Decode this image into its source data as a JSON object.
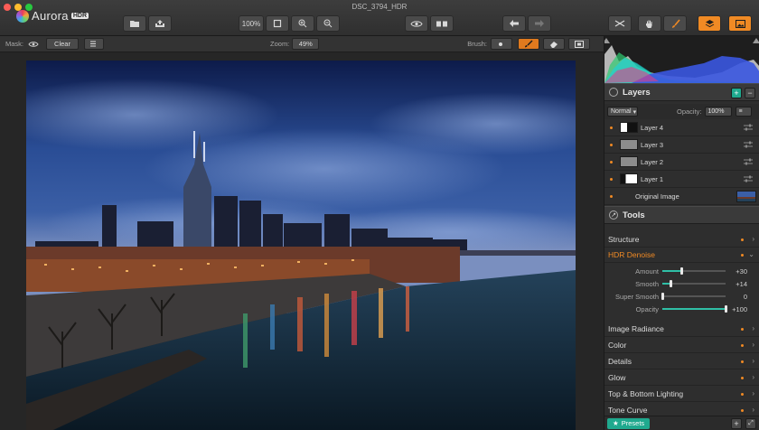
{
  "window": {
    "title": "DSC_3794_HDR"
  },
  "app": {
    "name": "Aurora",
    "badge": "HDR"
  },
  "toolbar": {
    "zoom_fit_label": "100%",
    "icons": [
      "open-icon",
      "share-icon",
      "fit-icon",
      "zoom-in-icon",
      "zoom-out-icon",
      "eye-icon",
      "compare-icon",
      "undo-icon",
      "redo-icon",
      "crop-icon",
      "hand-icon",
      "brush-tool-icon",
      "layers-icon",
      "image-view-icon"
    ]
  },
  "subbar": {
    "mask_label": "Mask:",
    "clear_label": "Clear",
    "zoom_label": "Zoom:",
    "zoom_value": "49%",
    "brush_label": "Brush:"
  },
  "layers": {
    "title": "Layers",
    "blend_mode": "Normal",
    "opacity_label": "Opacity:",
    "opacity_value": "100%",
    "items": [
      {
        "name": "Layer 4"
      },
      {
        "name": "Layer 3"
      },
      {
        "name": "Layer 2"
      },
      {
        "name": "Layer 1"
      },
      {
        "name": "Original Image"
      }
    ]
  },
  "tools": {
    "title": "Tools",
    "items": [
      {
        "name": "Structure"
      },
      {
        "name": "HDR Denoise"
      },
      {
        "name": "Image Radiance"
      },
      {
        "name": "Color"
      },
      {
        "name": "Details"
      },
      {
        "name": "Glow"
      },
      {
        "name": "Top & Bottom Lighting"
      },
      {
        "name": "Tone Curve"
      }
    ],
    "denoise_params": [
      {
        "label": "Amount",
        "value": "+30",
        "fraction": 0.3
      },
      {
        "label": "Smooth",
        "value": "+14",
        "fraction": 0.14
      },
      {
        "label": "Super Smooth",
        "value": "0",
        "fraction": 0.0
      },
      {
        "label": "Opacity",
        "value": "+100",
        "fraction": 1.0
      }
    ]
  },
  "footer": {
    "presets_label": "Presets"
  },
  "colors": {
    "accent": "#f08a24",
    "teal": "#1fa98e"
  }
}
